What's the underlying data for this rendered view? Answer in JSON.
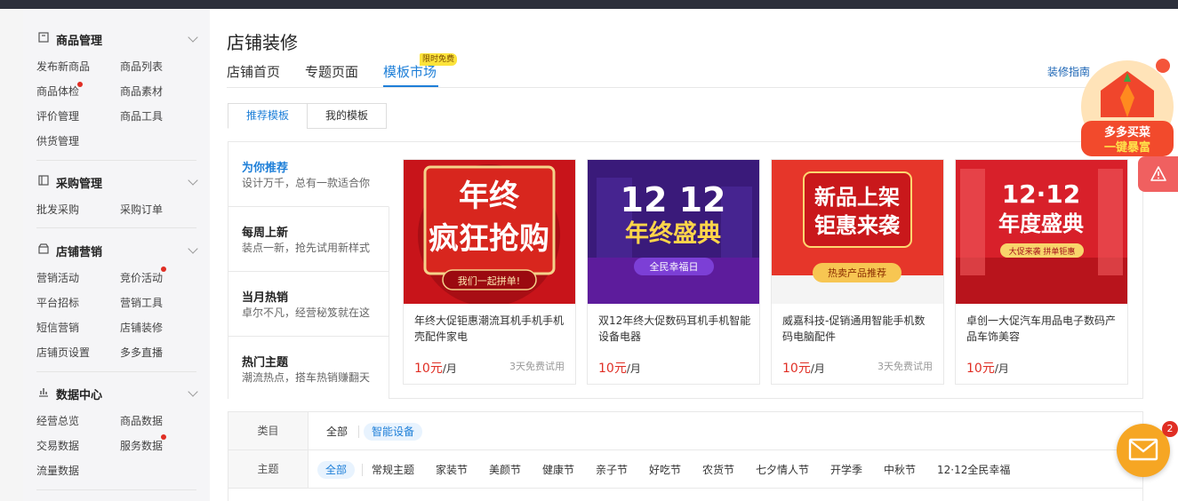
{
  "sidebar": {
    "groups": [
      {
        "title": "商品管理",
        "icon": "box-icon",
        "items": [
          "发布新商品",
          "商品列表",
          "商品体检",
          "商品素材",
          "评价管理",
          "商品工具",
          "供货管理"
        ]
      },
      {
        "title": "采购管理",
        "icon": "purchase-icon",
        "items": [
          "批发采购",
          "采购订单"
        ]
      },
      {
        "title": "店铺营销",
        "icon": "store-icon",
        "items": [
          "营销活动",
          "竞价活动",
          "平台招标",
          "营销工具",
          "短信营销",
          "店铺装修",
          "店铺页设置",
          "多多直播"
        ]
      },
      {
        "title": "数据中心",
        "icon": "bar-chart-icon",
        "items": [
          "经营总览",
          "商品数据",
          "交易数据",
          "服务数据",
          "流量数据"
        ]
      }
    ]
  },
  "main": {
    "title": "店铺装修",
    "tabs": [
      "店铺首页",
      "专题页面",
      "模板市场"
    ],
    "tab_badge": "限时免费",
    "guide_link": "装修指南",
    "subtabs": [
      "推荐模板",
      "我的模板"
    ],
    "recommend": [
      {
        "title": "为你推荐",
        "sub": "设计万千，总有一款适合你"
      },
      {
        "title": "每周上新",
        "sub": "装点一新，抢先试用新样式"
      },
      {
        "title": "当月热销",
        "sub": "卓尔不凡，经营秘笈就在这"
      },
      {
        "title": "热门主题",
        "sub": "潮流热点，搭车热销赚翻天"
      }
    ],
    "cards": [
      {
        "title": "年终大促钜惠潮流耳机手机手机壳配件家电",
        "price": "10元",
        "unit": "/月",
        "trial": "3天免费试用",
        "banner": [
          "年终",
          "疯狂抢购",
          "我们一起拼单!"
        ]
      },
      {
        "title": "双12年终大促数码耳机手机智能设备电器",
        "price": "10元",
        "unit": "/月",
        "trial": "",
        "banner": [
          "12 12",
          "年终盛典",
          "全民幸福日"
        ]
      },
      {
        "title": "威嘉科技-促销通用智能手机数码电脑配件",
        "price": "10元",
        "unit": "/月",
        "trial": "3天免费试用",
        "banner": [
          "新品上架",
          "钜惠来袭",
          "热卖产品推荐"
        ]
      },
      {
        "title": "卓创一大促汽车用品电子数码产品车饰美容",
        "price": "10元",
        "unit": "/月",
        "trial": "",
        "banner": [
          "12·12",
          "年度盛典",
          "大促来袭 拼单钜惠"
        ]
      }
    ],
    "filters": {
      "category_label": "类目",
      "categories": [
        "全部",
        "智能设备"
      ],
      "theme_label": "主题",
      "themes": [
        "全部",
        "常规主题",
        "家装节",
        "美颜节",
        "健康节",
        "亲子节",
        "好吃节",
        "农货节",
        "七夕情人节",
        "开学季",
        "中秋节",
        "12·12全民幸福"
      ]
    }
  },
  "widgets": {
    "promo_text": [
      "多多买菜",
      "一键暴富"
    ],
    "message_count": "2"
  },
  "colors": {
    "accent": "#1e7fd8",
    "price": "#e02e24",
    "message": "#f6a623"
  }
}
